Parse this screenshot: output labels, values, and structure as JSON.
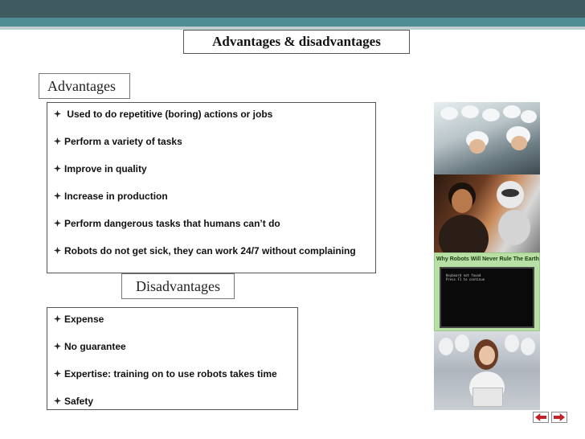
{
  "slide": {
    "title": "Advantages & disadvantages",
    "advantages_label": "Advantages",
    "disadvantages_label": "Disadvantages"
  },
  "advantages": [
    " Used to do repetitive (boring) actions or jobs",
    "Perform a variety of tasks",
    "Improve in quality",
    "Increase in production",
    "Perform dangerous tasks that humans can’t do",
    "Robots do not get sick, they can work 24/7 without complaining"
  ],
  "disadvantages": [
    "Expense",
    "No guarantee",
    "Expertise: training on to use robots takes time",
    "Safety"
  ],
  "images": {
    "robot_poster_caption": "Why Robots Will Never Rule The Earth",
    "robot_poster_screen_text": "Keyboard not found\nPress F1 to continue"
  },
  "colors": {
    "header_dark": "#3f5b5f",
    "header_teal": "#4f8d94",
    "nav_arrow": "#c0232a"
  },
  "icons": {
    "bullet": "diamond-star-bullet-icon",
    "prev": "arrow-left-icon",
    "next": "arrow-right-icon"
  }
}
